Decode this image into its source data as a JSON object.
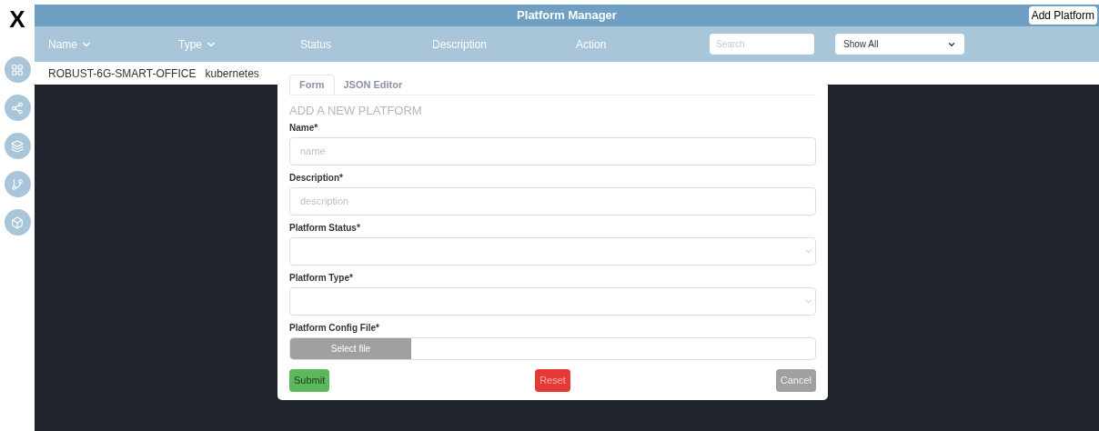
{
  "logo": {
    "text": "X"
  },
  "title": "Platform Manager",
  "add_button": "Add Platform",
  "columns": [
    {
      "label": "Name",
      "sortable": true
    },
    {
      "label": "Type",
      "sortable": true
    },
    {
      "label": "Status",
      "sortable": false
    },
    {
      "label": "Description",
      "sortable": false
    },
    {
      "label": "Action",
      "sortable": false
    }
  ],
  "search": {
    "placeholder": "Search"
  },
  "filter": {
    "value": "Show All"
  },
  "rows": [
    {
      "name": "ROBUST-6G-SMART-OFFICE",
      "type": "kubernetes"
    }
  ],
  "modal": {
    "tabs": [
      {
        "label": "Form",
        "selected": true
      },
      {
        "label": "JSON Editor",
        "selected": false
      }
    ],
    "heading": "ADD A NEW PLATFORM",
    "fields": [
      {
        "kind": "text",
        "label": "Name*",
        "placeholder": "name"
      },
      {
        "kind": "text",
        "label": "Description*",
        "placeholder": "description"
      },
      {
        "kind": "select",
        "label": "Platform Status*"
      },
      {
        "kind": "select",
        "label": "Platform Type*"
      },
      {
        "kind": "file",
        "label": "Platform Config File*",
        "button": "Select file"
      }
    ],
    "buttons": [
      {
        "kind": "submit",
        "label": "Submit",
        "disabled": false
      },
      {
        "kind": "reset",
        "label": "Reset",
        "disabled": false
      },
      {
        "kind": "cancel",
        "label": "Cancel",
        "disabled": true
      }
    ]
  }
}
